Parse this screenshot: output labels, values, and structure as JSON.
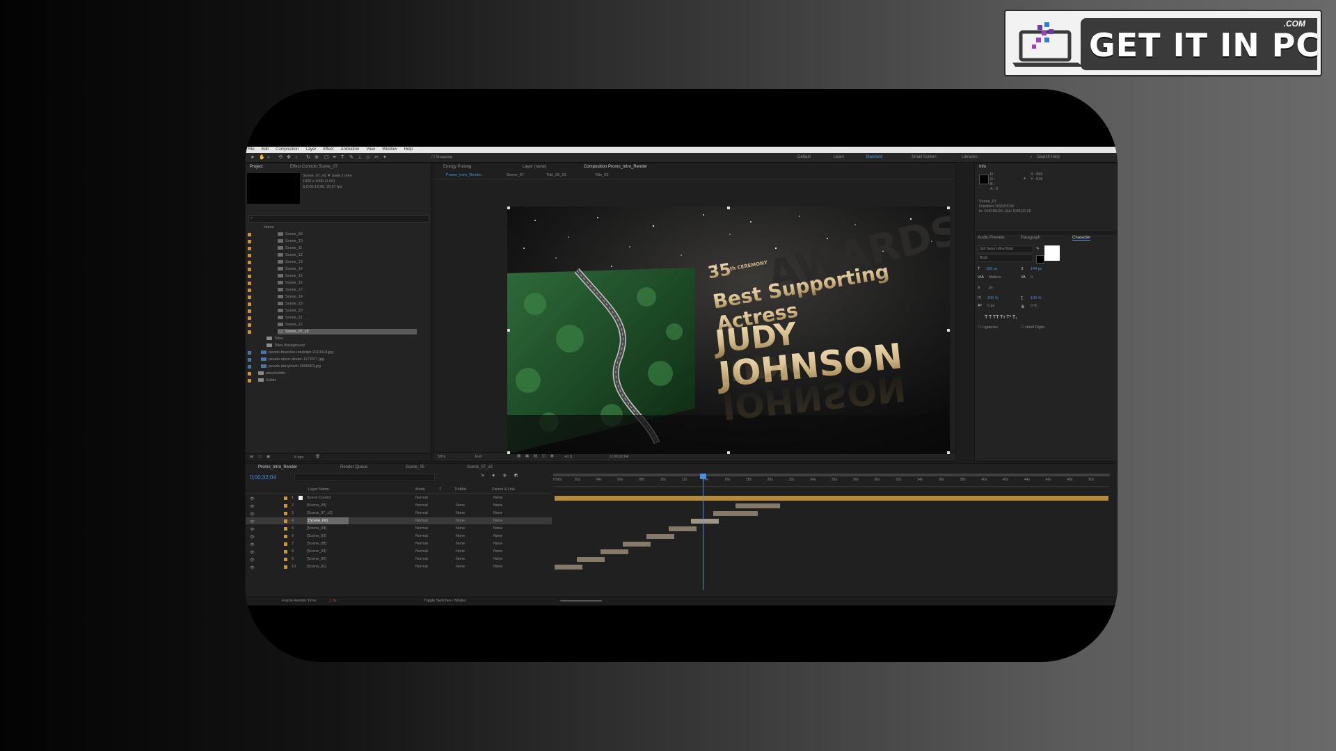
{
  "watermark": {
    "brand": "GET IT IN PC",
    "suffix": ".COM"
  },
  "menu": [
    "File",
    "Edit",
    "Composition",
    "Layer",
    "Effect",
    "Animation",
    "View",
    "Window",
    "Help"
  ],
  "toolbar": {
    "snapping_label": "Snapping",
    "workspaces": [
      "Default",
      "Learn",
      "Standard",
      "Small Screen",
      "Libraries"
    ],
    "active_workspace": "Standard",
    "search_label": "Search Help"
  },
  "project_panel": {
    "tabs": [
      "Project",
      "Effect Controls Scene_07"
    ],
    "selected_name": "Scene_07_v2 ▼ used 1 time",
    "selected_info": [
      "1920 x 1080 (1.00)",
      "Δ 0;00;16;00, 29.97 fps"
    ],
    "column_name": "Name",
    "items": [
      "Scene_09",
      "Scene_10",
      "Scene_11",
      "Scene_12",
      "Scene_13",
      "Scene_14",
      "Scene_15",
      "Scene_16",
      "Scene_17",
      "Scene_18",
      "Scene_19",
      "Scene_20",
      "Scene_21",
      "Scene_22",
      "Scene_07_v2"
    ],
    "folders": [
      "Titles",
      "Titles Background"
    ],
    "files": [
      "pexels-brandon-randolph-2010018.jpg",
      "pexels-steve-dexter-1172077.jpg",
      "pexels-darrylirwin-3999063.jpg"
    ],
    "more_folders": [
      "placeholder",
      "Solids"
    ],
    "bpc": "8 bpc"
  },
  "composition_panel": {
    "tabs": [
      "Energy Pulsing",
      "Layer (none)",
      "Composition Promo_Intro_Render"
    ],
    "breadcrumbs": [
      "Promo_Intro_Render",
      "Scene_07",
      "Title_05_03",
      "Title_03"
    ],
    "zoom": "50%",
    "resolution": "Full",
    "timecode": "0;00;02;04",
    "exposure": "+0.0"
  },
  "scene": {
    "edition_number": "35",
    "edition_suffix": "th CEREMONY",
    "category_line1": "Best Supporting",
    "category_line2": "Actress",
    "name_line1": "JUDY",
    "name_line2": "JOHNSON",
    "bg_text": "AWARDS"
  },
  "info_panel": {
    "tab": "Info",
    "rgb_labels": [
      "R :",
      "G :",
      "B :",
      "A : 0"
    ],
    "coords": [
      "X : 896",
      "Y : 538"
    ],
    "layer_name": "Scene_07",
    "duration": "Duration: 0;00;03;00",
    "in_out": "In: 0;00;00;00, Out: 0;00;02;29"
  },
  "character_panel": {
    "tabs": [
      "Audio",
      "Preview",
      "Paragraph",
      "Character"
    ],
    "font": "Gill Sans Ultra Bold",
    "style": "Bold",
    "size": "109 px",
    "leading": "144 px",
    "tracking": "Metrics",
    "kerning": "0",
    "stroke": "px",
    "vscale": "100 %",
    "hscale": "100 %",
    "baseline": "0 px",
    "tsume": "0 %",
    "ligatures": "Ligatures",
    "hindi_digits": "Hindi Digits"
  },
  "timeline": {
    "tabs": [
      "Promo_Intro_Render",
      "Render Queue",
      "Scene_05",
      "Scene_07_v2"
    ],
    "timecode": "0;00;32;04",
    "columns": [
      "Layer Name",
      "Mode",
      "T",
      "TrkMat",
      "Parent & Link"
    ],
    "layers": [
      {
        "num": "1",
        "name": "Scene Control",
        "mode": "Normal",
        "trk": "",
        "parent": "None"
      },
      {
        "num": "2",
        "name": "[Scene_05]",
        "mode": "Normal",
        "trk": "None",
        "parent": "None"
      },
      {
        "num": "3",
        "name": "[Scene_07_v2]",
        "mode": "Normal",
        "trk": "None",
        "parent": "None"
      },
      {
        "num": "4",
        "name": "[Scene_06]",
        "mode": "Normal",
        "trk": "None",
        "parent": "None"
      },
      {
        "num": "5",
        "name": "[Scene_04]",
        "mode": "Normal",
        "trk": "None",
        "parent": "None"
      },
      {
        "num": "6",
        "name": "[Scene_03]",
        "mode": "Normal",
        "trk": "None",
        "parent": "None"
      },
      {
        "num": "7",
        "name": "[Scene_08]",
        "mode": "Normal",
        "trk": "None",
        "parent": "None"
      },
      {
        "num": "8",
        "name": "[Scene_09]",
        "mode": "Normal",
        "trk": "None",
        "parent": "None"
      },
      {
        "num": "9",
        "name": "[Scene_02]",
        "mode": "Normal",
        "trk": "None",
        "parent": "None"
      },
      {
        "num": "10",
        "name": "[Scene_01]",
        "mode": "Normal",
        "trk": "None",
        "parent": "None"
      }
    ],
    "ruler": [
      "0:00s",
      "02s",
      "04s",
      "06s",
      "08s",
      "10s",
      "12s",
      "14s",
      "16s",
      "18s",
      "20s",
      "22s",
      "24s",
      "26s",
      "28s",
      "30s",
      "32s",
      "34s",
      "36s",
      "38s",
      "40s",
      "42s",
      "44s",
      "46s",
      "48s",
      "50s"
    ],
    "frame_render_label": "Frame Render Time:",
    "frame_render_value": "1.5s",
    "toggle_label": "Toggle Switches / Modes"
  },
  "colors": {
    "accent": "#4a8fe0",
    "highlight_bar": "#b68a3c",
    "layer_bar": "#857a6a",
    "label_orange": "#c9943b"
  }
}
